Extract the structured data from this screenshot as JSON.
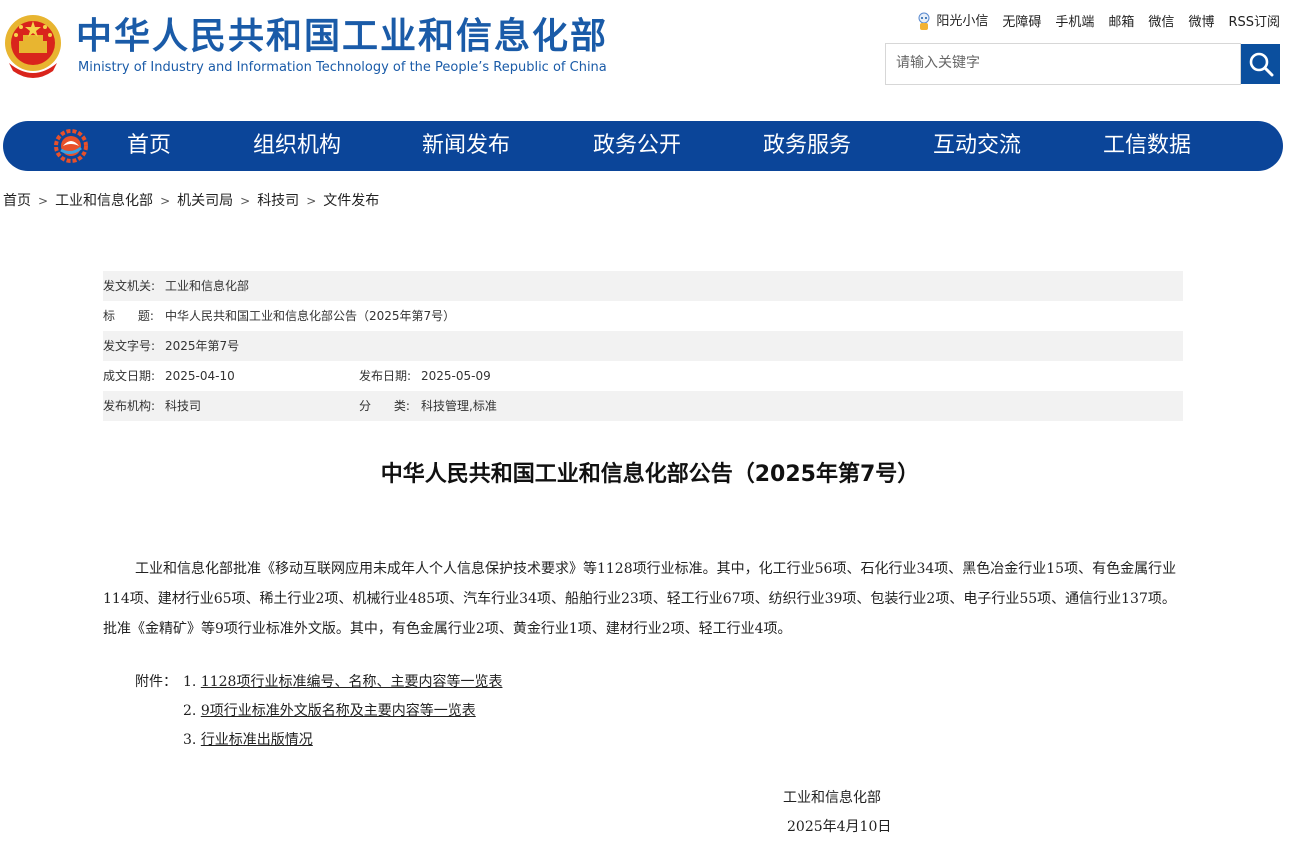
{
  "header": {
    "title_cn": "中华人民共和国工业和信息化部",
    "title_en": "Ministry of Industry and Information Technology of the People’s Republic of China",
    "toplinks": [
      "阳光小信",
      "无障碍",
      "手机端",
      "邮箱",
      "微信",
      "微博",
      "RSS订阅"
    ],
    "search_placeholder": "请输入关键字"
  },
  "nav": {
    "items": [
      "首页",
      "组织机构",
      "新闻发布",
      "政务公开",
      "政务服务",
      "互动交流",
      "工信数据"
    ]
  },
  "breadcrumb": [
    "首页",
    "工业和信息化部",
    "机关司局",
    "科技司",
    "文件发布"
  ],
  "info": {
    "issuer_label": "发文机关:",
    "issuer": "工业和信息化部",
    "title_label": "标      题:",
    "title": "中华人民共和国工业和信息化部公告（2025年第7号）",
    "docno_label": "发文字号:",
    "docno": "2025年第7号",
    "written_label": "成文日期:",
    "written": "2025-04-10",
    "published_label": "发布日期:",
    "published": "2025-05-09",
    "org_label": "发布机构:",
    "org": "科技司",
    "category_label": "分      类:",
    "category": "科技管理,标准"
  },
  "article": {
    "title": "中华人民共和国工业和信息化部公告（2025年第7号）",
    "body": "工业和信息化部批准《移动互联网应用未成年人个人信息保护技术要求》等1128项行业标准。其中，化工行业56项、石化行业34项、黑色冶金行业15项、有色金属行业114项、建材行业65项、稀土行业2项、机械行业485项、汽车行业34项、船舶行业23项、轻工行业67项、纺织行业39项、包装行业2项、电子行业55项、通信行业137项。批准《金精矿》等9项行业标准外文版。其中，有色金属行业2项、黄金行业1项、建材行业2项、轻工行业4项。",
    "attachments_label": "附件：",
    "attachments": [
      {
        "num": "1.",
        "text": "1128项行业标准编号、名称、主要内容等一览表"
      },
      {
        "num": "2.",
        "text": "9项行业标准外文版名称及主要内容等一览表"
      },
      {
        "num": "3.",
        "text": "行业标准出版情况"
      }
    ],
    "signature": "工业和信息化部",
    "date": "2025年4月10日"
  },
  "colors": {
    "brand_blue": "#0b4599",
    "title_blue": "#1a5ba8",
    "row_shade": "#f2f2f2"
  }
}
